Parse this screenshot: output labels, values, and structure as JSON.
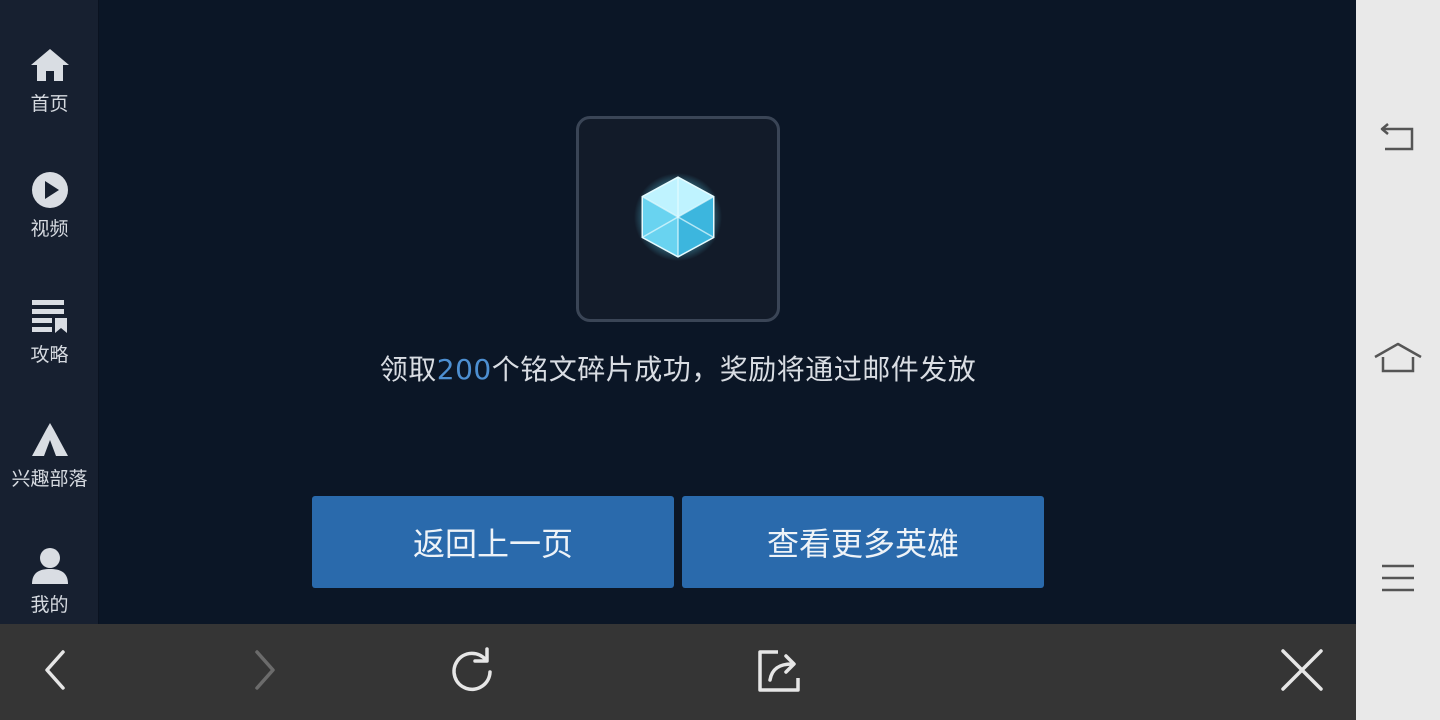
{
  "sidebar": {
    "items": [
      {
        "label": "首页",
        "icon": "home-icon"
      },
      {
        "label": "视频",
        "icon": "play-icon"
      },
      {
        "label": "攻略",
        "icon": "guide-icon"
      },
      {
        "label": "兴趣部落",
        "icon": "tribe-icon"
      },
      {
        "label": "我的",
        "icon": "user-icon"
      }
    ]
  },
  "main": {
    "reward_icon": "inscription-crystal-icon",
    "message_prefix": "领取",
    "message_count": "200",
    "message_suffix": "个铭文碎片成功，奖励将通过邮件发放",
    "highlight_color": "#4d8fd1",
    "buttons": {
      "back": "返回上一页",
      "more_heroes": "查看更多英雄"
    },
    "button_color": "#2a6aac"
  },
  "toolbar": {
    "items": [
      "back-arrow-icon",
      "forward-arrow-icon",
      "refresh-icon",
      "share-icon",
      "close-icon"
    ]
  },
  "system_nav": {
    "items": [
      "back-icon",
      "home-icon",
      "menu-icon"
    ]
  }
}
